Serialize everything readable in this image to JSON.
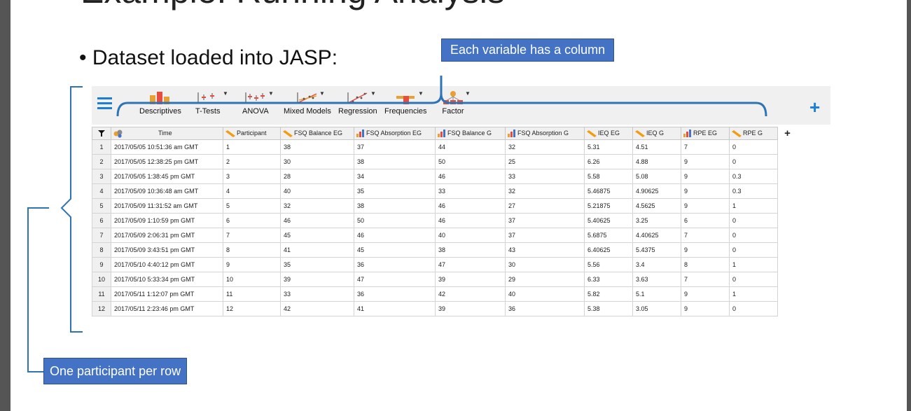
{
  "slide": {
    "title_partial": "Example: Running Analysis",
    "bullet": "• Dataset loaded into JASP:",
    "callout_columns": "Each variable has a column",
    "callout_rows": "One participant per row"
  },
  "colors": {
    "accent_blue": "#1d7ed8",
    "callout_blue": "#4472c4",
    "bracket_blue": "#2e74b5",
    "scale_orange": "#f39c12",
    "nominal_orange": "#e8a033",
    "chart_red": "#e74c3c",
    "toolbar_bg": "#f0f0f0"
  },
  "toolbar": {
    "menu_icon": "hamburger-icon",
    "add_icon": "plus-icon",
    "add_label": "+",
    "items": [
      {
        "label": "Descriptives",
        "icon": "bar-chart-icon"
      },
      {
        "label": "T-Tests",
        "icon": "ttest-icon"
      },
      {
        "label": "ANOVA",
        "icon": "anova-icon"
      },
      {
        "label": "Mixed Models",
        "icon": "mixed-models-icon"
      },
      {
        "label": "Regression",
        "icon": "regression-icon"
      },
      {
        "label": "Frequencies",
        "icon": "frequencies-icon"
      },
      {
        "label": "Factor",
        "icon": "factor-icon"
      }
    ]
  },
  "table": {
    "filter_icon": "filter-icon",
    "add_column_label": "+",
    "columns": [
      {
        "label": "Time",
        "type": "nominal-text"
      },
      {
        "label": "Participant",
        "type": "scale"
      },
      {
        "label": "FSQ Balance EG",
        "type": "scale"
      },
      {
        "label": "FSQ Absorption EG",
        "type": "ordinal"
      },
      {
        "label": "FSQ Balance G",
        "type": "ordinal"
      },
      {
        "label": "FSQ Absorption G",
        "type": "ordinal"
      },
      {
        "label": "IEQ EG",
        "type": "scale"
      },
      {
        "label": "IEQ G",
        "type": "scale"
      },
      {
        "label": "RPE EG",
        "type": "ordinal"
      },
      {
        "label": "RPE G",
        "type": "scale"
      }
    ],
    "rows": [
      {
        "n": "1",
        "cells": [
          "2017/05/05 10:51:36 am GMT",
          "1",
          "38",
          "37",
          "44",
          "32",
          "5.31",
          "4.51",
          "7",
          "0"
        ]
      },
      {
        "n": "2",
        "cells": [
          "2017/05/05 12:38:25 pm GMT",
          "2",
          "30",
          "38",
          "50",
          "25",
          "6.26",
          "4.88",
          "9",
          "0"
        ]
      },
      {
        "n": "3",
        "cells": [
          "2017/05/05 1:38:45 pm GMT",
          "3",
          "28",
          "34",
          "46",
          "33",
          "5.58",
          "5.08",
          "9",
          "0.3"
        ]
      },
      {
        "n": "4",
        "cells": [
          "2017/05/09 10:36:48 am GMT",
          "4",
          "40",
          "35",
          "33",
          "32",
          "5.46875",
          "4.90625",
          "9",
          "0.3"
        ]
      },
      {
        "n": "5",
        "cells": [
          "2017/05/09 11:31:52 am GMT",
          "5",
          "32",
          "38",
          "46",
          "27",
          "5.21875",
          "4.5625",
          "9",
          "1"
        ]
      },
      {
        "n": "6",
        "cells": [
          "2017/05/09 1:10:59 pm GMT",
          "6",
          "46",
          "50",
          "46",
          "37",
          "5.40625",
          "3.25",
          "6",
          "0"
        ]
      },
      {
        "n": "7",
        "cells": [
          "2017/05/09 2:06:31 pm GMT",
          "7",
          "45",
          "46",
          "40",
          "37",
          "5.6875",
          "4.40625",
          "7",
          "0"
        ]
      },
      {
        "n": "8",
        "cells": [
          "2017/05/09 3:43:51 pm GMT",
          "8",
          "41",
          "45",
          "38",
          "43",
          "6.40625",
          "5.4375",
          "9",
          "0"
        ]
      },
      {
        "n": "9",
        "cells": [
          "2017/05/10 4:40:12 pm GMT",
          "9",
          "35",
          "36",
          "47",
          "30",
          "5.56",
          "3.4",
          "8",
          "1"
        ]
      },
      {
        "n": "10",
        "cells": [
          "2017/05/10 5:33:34 pm GMT",
          "10",
          "39",
          "47",
          "39",
          "29",
          "6.33",
          "3.63",
          "7",
          "0"
        ]
      },
      {
        "n": "11",
        "cells": [
          "2017/05/11 1:12:07 pm GMT",
          "11",
          "33",
          "36",
          "42",
          "40",
          "5.82",
          "5.1",
          "9",
          "1"
        ]
      },
      {
        "n": "12",
        "cells": [
          "2017/05/11 2:23:46 pm GMT",
          "12",
          "42",
          "41",
          "39",
          "36",
          "5.38",
          "3.05",
          "9",
          "0"
        ]
      }
    ]
  }
}
